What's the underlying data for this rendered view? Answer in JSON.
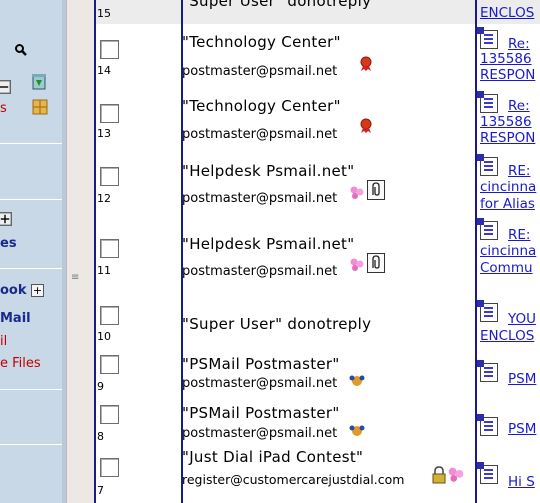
{
  "sidebar": {
    "items": [
      {
        "label": "s",
        "color": "#c00000"
      },
      {
        "label": "es",
        "color": "#1a2a8a"
      },
      {
        "label": "ook",
        "color": "#1a2a8a"
      },
      {
        "label": "Mail",
        "color": "#1a2a8a"
      },
      {
        "label": "il",
        "color": "#c00000"
      },
      {
        "label": "e Files",
        "color": "#c00000"
      }
    ],
    "expand_symbol": "+",
    "splitter_grip": "≡"
  },
  "messages": [
    {
      "num": "15",
      "name": "\"Super User\" donotreply",
      "email": "",
      "subject_lines": [
        "ENCLOS"
      ],
      "status_icons": []
    },
    {
      "num": "14",
      "name": "\"Technology Center\"",
      "email": "postmaster@psmail.net",
      "subject_lines": [
        "Re:",
        "135586",
        "RESPON"
      ],
      "status_icons": [
        "award-icon"
      ]
    },
    {
      "num": "13",
      "name": "\"Technology Center\"",
      "email": "postmaster@psmail.net",
      "subject_lines": [
        "Re:",
        "135586",
        "RESPON"
      ],
      "status_icons": [
        "award-icon"
      ]
    },
    {
      "num": "12",
      "name": "\"Helpdesk Psmail.net\"",
      "email": "postmaster@psmail.net",
      "subject_lines": [
        "RE:",
        "cincinna",
        "for Alias"
      ],
      "status_icons": [
        "flowers-icon",
        "attachment-icon"
      ]
    },
    {
      "num": "11",
      "name": "\"Helpdesk Psmail.net\"",
      "email": "postmaster@psmail.net",
      "subject_lines": [
        "RE:",
        "cincinna",
        "Commu"
      ],
      "status_icons": [
        "flowers-icon",
        "attachment-icon"
      ]
    },
    {
      "num": "10",
      "name": "\"Super User\" donotreply",
      "email": "",
      "subject_lines": [
        "YOU",
        "ENCLOS"
      ],
      "status_icons": []
    },
    {
      "num": "9",
      "name": "\"PSMail Postmaster\"",
      "email": "postmaster@psmail.net",
      "subject_lines": [
        "PSM"
      ],
      "status_icons": [
        "people-icon"
      ]
    },
    {
      "num": "8",
      "name": "\"PSMail Postmaster\"",
      "email": "postmaster@psmail.net",
      "subject_lines": [
        "PSM"
      ],
      "status_icons": [
        "people-icon"
      ]
    },
    {
      "num": "7",
      "name": "\"Just Dial iPad Contest\"",
      "email": "register@customercarejustdial.com",
      "subject_lines": [
        "Hi S"
      ],
      "status_icons": [
        "lock-icon",
        "flowers-icon"
      ]
    }
  ],
  "colors": {
    "link": "#1a1acc",
    "border": "#1a1a8a",
    "sidebar_bg": "#c9d8e6"
  }
}
